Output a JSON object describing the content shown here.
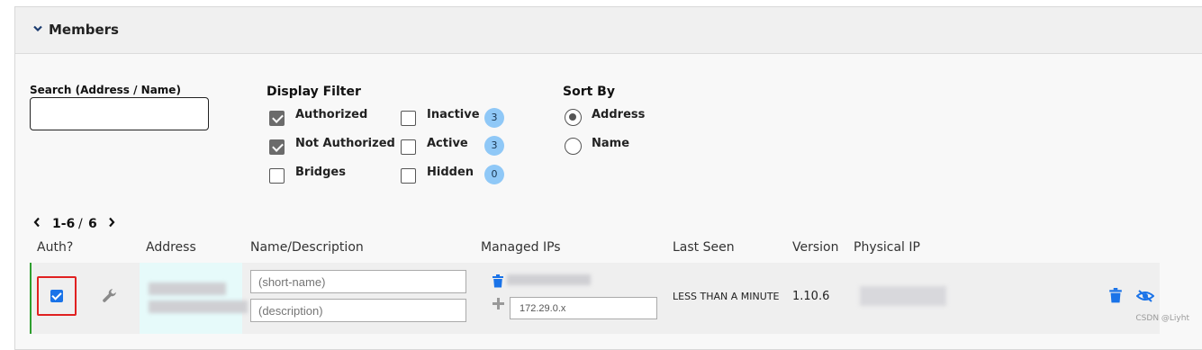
{
  "panel": {
    "title": "Members",
    "chevron_icon": "chevron-down-icon"
  },
  "search": {
    "label": "Search (Address / Name)",
    "value": "",
    "placeholder": ""
  },
  "display_filter": {
    "heading": "Display Filter",
    "options": [
      {
        "label": "Authorized",
        "checked": true
      },
      {
        "label": "Not Authorized",
        "checked": true
      },
      {
        "label": "Bridges",
        "checked": false
      },
      {
        "label": "Inactive",
        "checked": false,
        "count": "3"
      },
      {
        "label": "Active",
        "checked": false,
        "count": "3"
      },
      {
        "label": "Hidden",
        "checked": false,
        "count": "0"
      }
    ]
  },
  "sort_by": {
    "heading": "Sort By",
    "options": [
      {
        "label": "Address",
        "selected": true
      },
      {
        "label": "Name",
        "selected": false
      }
    ]
  },
  "pagination": {
    "range": "1-6",
    "separator": "/",
    "total": "6"
  },
  "table": {
    "columns": [
      "Auth?",
      "Address",
      "Name/Description",
      "Managed IPs",
      "Last Seen",
      "Version",
      "Physical IP"
    ],
    "row": {
      "authorized": true,
      "short_name_placeholder": "(short-name)",
      "description_placeholder": "(description)",
      "ip_input_value": "172.29.0.x",
      "last_seen": "LESS THAN A MINUTE",
      "version": "1.10.6",
      "icons": [
        "wrench-icon",
        "trash-icon",
        "plus-icon",
        "trash-icon",
        "eye-off-icon"
      ],
      "colors": {
        "auth_check": "#1a73e8",
        "highlight": "#e02020",
        "active_bar": "#2e9e2e",
        "action_icon": "#1a73e8"
      }
    }
  },
  "watermark": "CSDN @Liyht"
}
